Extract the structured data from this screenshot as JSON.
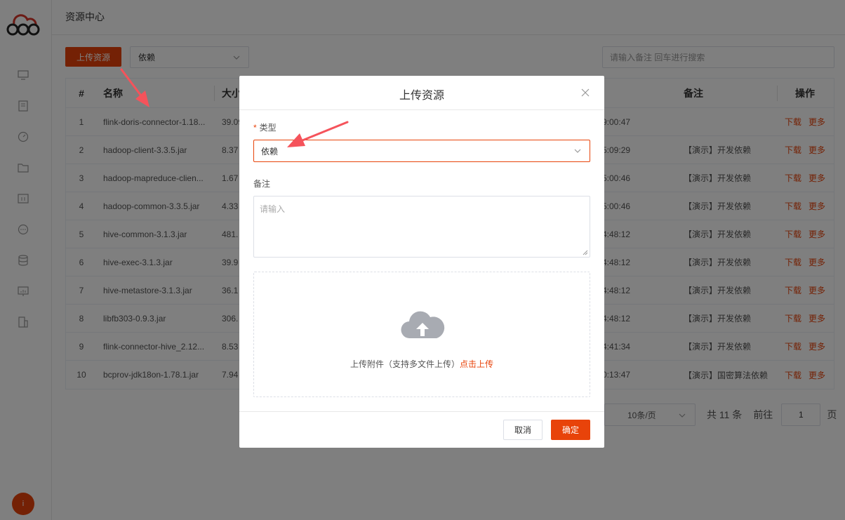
{
  "header": {
    "title": "资源中心"
  },
  "toolbar": {
    "upload_label": "上传资源",
    "type_value": "依赖",
    "search_placeholder": "请输入备注 回车进行搜索"
  },
  "table": {
    "columns": [
      "#",
      "名称",
      "大小",
      "",
      "备注",
      "操作"
    ],
    "rows": [
      {
        "idx": "1",
        "name": "flink-doris-connector-1.18...",
        "size": "39.09",
        "time": "9:00:47",
        "note": "",
        "download": "下载",
        "more": "更多"
      },
      {
        "idx": "2",
        "name": "hadoop-client-3.3.5.jar",
        "size": "8.37",
        "time": "5:09:29",
        "note": "【演示】开发依赖",
        "download": "下载",
        "more": "更多"
      },
      {
        "idx": "3",
        "name": "hadoop-mapreduce-clien...",
        "size": "1.67",
        "time": "5:00:46",
        "note": "【演示】开发依赖",
        "download": "下载",
        "more": "更多"
      },
      {
        "idx": "4",
        "name": "hadoop-common-3.3.5.jar",
        "size": "4.33",
        "time": "5:00:46",
        "note": "【演示】开发依赖",
        "download": "下载",
        "more": "更多"
      },
      {
        "idx": "5",
        "name": "hive-common-3.1.3.jar",
        "size": "481.",
        "time": "4:48:12",
        "note": "【演示】开发依赖",
        "download": "下载",
        "more": "更多"
      },
      {
        "idx": "6",
        "name": "hive-exec-3.1.3.jar",
        "size": "39.9",
        "time": "4:48:12",
        "note": "【演示】开发依赖",
        "download": "下载",
        "more": "更多"
      },
      {
        "idx": "7",
        "name": "hive-metastore-3.1.3.jar",
        "size": "36.1",
        "time": "4:48:12",
        "note": "【演示】开发依赖",
        "download": "下载",
        "more": "更多"
      },
      {
        "idx": "8",
        "name": "libfb303-0.9.3.jar",
        "size": "306.",
        "time": "4:48:12",
        "note": "【演示】开发依赖",
        "download": "下载",
        "more": "更多"
      },
      {
        "idx": "9",
        "name": "flink-connector-hive_2.12...",
        "size": "8.53",
        "time": "4:41:34",
        "note": "【演示】开发依赖",
        "download": "下载",
        "more": "更多"
      },
      {
        "idx": "10",
        "name": "bcprov-jdk18on-1.78.1.jar",
        "size": "7.94",
        "time": "0:13:47",
        "note": "【演示】国密算法依赖",
        "download": "下载",
        "more": "更多"
      }
    ]
  },
  "pagination": {
    "page_size": "10条/页",
    "total": "共 11 条",
    "goto": "前往",
    "page": "1",
    "unit": "页"
  },
  "modal": {
    "title": "上传资源",
    "type_label": "类型",
    "required_mark": "*",
    "type_value": "依赖",
    "note_label": "备注",
    "note_placeholder": "请输入",
    "drop_text": "上传附件（支持多文件上传）",
    "drop_link": "点击上传",
    "cancel_label": "取消",
    "ok_label": "确定"
  },
  "user": {
    "avatar_text": "i"
  },
  "colors": {
    "accent": "#e8430a",
    "arrow": "#f5535b"
  }
}
